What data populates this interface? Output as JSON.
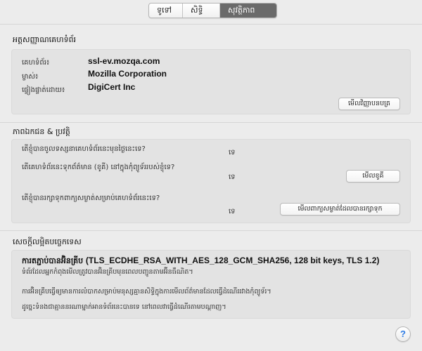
{
  "tabs": [
    {
      "label": "ទូទៅ",
      "selected": false
    },
    {
      "label": "សិទ្ធិ",
      "selected": false
    },
    {
      "label": "សុវត្ថិភាព",
      "selected": true
    }
  ],
  "identity": {
    "title": "អត្តសញ្ញាណគេហទំព័រ",
    "rows": [
      {
        "label": "គេហទំព័រ៖",
        "value": "ssl-ev.mozqa.com"
      },
      {
        "label": "ម្ចាស់៖",
        "value": "Mozilla Corporation"
      },
      {
        "label": "ផ្ទៀងផ្ទាត់ដោយ៖",
        "value": "DigiCert Inc"
      }
    ],
    "view_cert_button": "មើលវិញ្ញាបនបត្រ"
  },
  "privacy": {
    "title": "ភាពឯកជន & ប្រវត្តិ",
    "questions": [
      {
        "text": "តើខ្ញុំបានចូលទស្សនាគេហទំព័រនេះមុនថ្ងៃនេះទេ?",
        "answer": "ទេ"
      },
      {
        "text": "តើគេហទំព័រនេះទុកព័ត៌មាន (ខូគី) នៅក្នុងកុំព្យូទ័ររបស់ខ្ញុំទេ?",
        "answer": "ទេ",
        "button": "មើលខូគី"
      },
      {
        "text": "តើខ្ញុំបានរក្សាទុកពាក្យសម្ងាត់សម្រាប់គេហទំព័រនេះទេ?",
        "answer": "ទេ",
        "button": "មើលពាក្យសម្ងាត់ដែលបានរក្សាទុក"
      }
    ]
  },
  "technical": {
    "title": "សេចក្តីលម្អិតបច្ចេកទេស",
    "heading_prefix": "ការតភ្ជាប់បានអ៊ិនគ្រីប",
    "heading_detail": "(TLS_ECDHE_RSA_WITH_AES_128_GCM_SHA256, 128 bit keys, TLS 1.2)",
    "line1": "ទំព័រដែលអ្នកកំពុងមើលត្រូវបានអ៊ិនគ្រីបមុនពេលបញ្ជូនតាមអ៊ីនធឺណិត។",
    "line2": "ការអ៊ិនគ្រីបធ្វើឲ្យមានការលំបាកសម្រាប់មនុស្សគ្មានសិទ្ធិក្នុងការមើលព័ត៌មានដែលធ្វើដំណើររវាងកុំព្យូទ័រ។",
    "line3": "ដូច្នេះទំនងជាគ្មាននរណាម្នាក់អានទំព័រនេះបានទេ នៅពេលវាធ្វើដំណើរតាមបណ្តាញ។"
  },
  "help_label": "?"
}
